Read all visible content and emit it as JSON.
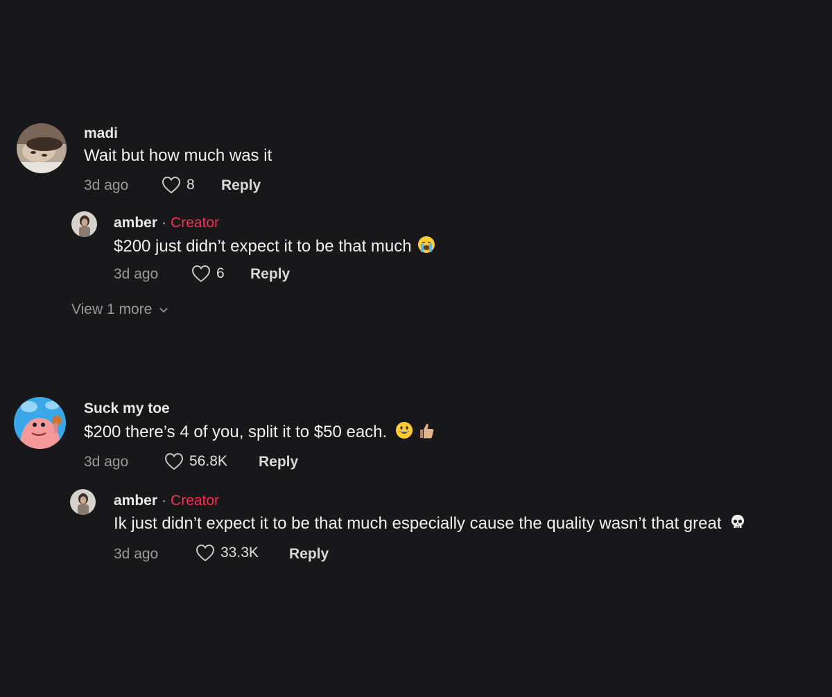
{
  "comments": [
    {
      "username": "madi",
      "text": "Wait but how much was it",
      "time": "3d ago",
      "likes": "8",
      "reply_label": "Reply",
      "replies": [
        {
          "username": "amber",
          "separator": "·",
          "badge": "Creator",
          "text": "$200 just didn’t expect it to be that much",
          "emoji": "loudly-crying-face",
          "time": "3d ago",
          "likes": "6",
          "reply_label": "Reply"
        }
      ],
      "view_more": "View 1 more"
    },
    {
      "username": "Suck my toe",
      "text": "$200 there’s 4 of you, split it to $50 each.",
      "emoji": [
        "grinning-face",
        "thumbs-up"
      ],
      "time": "3d ago",
      "likes": "56.8K",
      "reply_label": "Reply",
      "replies": [
        {
          "username": "amber",
          "separator": "·",
          "badge": "Creator",
          "text": "Ik just didn’t expect it to be that much especially cause the quality wasn’t that great",
          "emoji": "skull",
          "time": "3d ago",
          "likes": "33.3K",
          "reply_label": "Reply"
        }
      ]
    }
  ],
  "colors": {
    "background": "#18181a",
    "creator_badge": "#fe2c55",
    "meta_text": "#9a9a9a"
  }
}
